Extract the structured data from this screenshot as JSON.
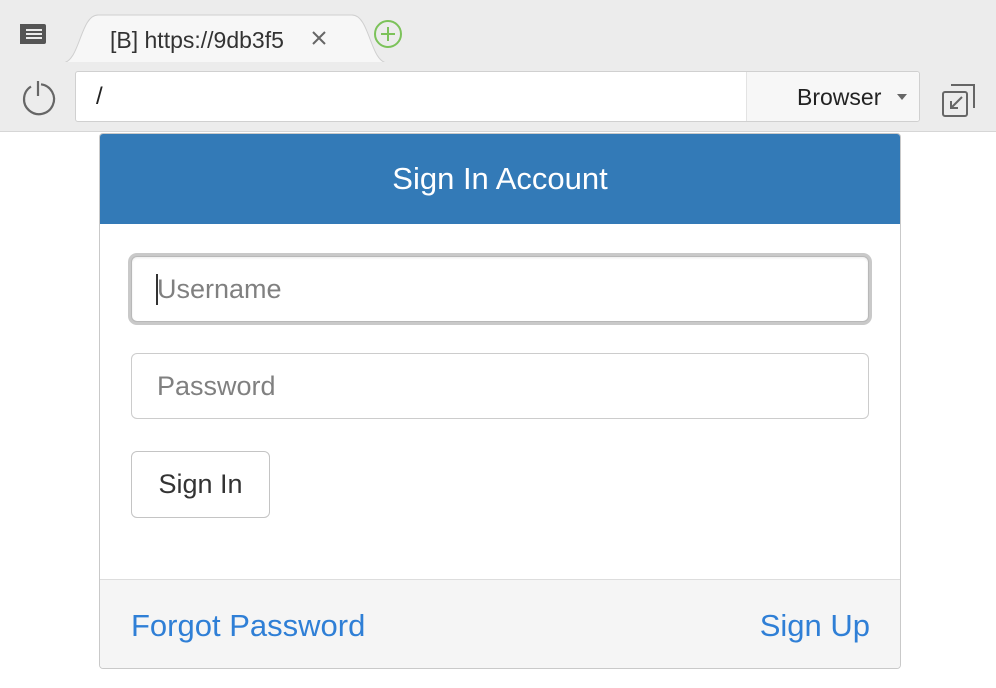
{
  "browser": {
    "tab_title": "[B] https://9db3f5",
    "url": "/",
    "browser_select": "Browser"
  },
  "colors": {
    "header_bg": "#337ab7",
    "link": "#2f7fd6",
    "new_tab_icon": "#7cc25a"
  },
  "icons": {
    "menu": "menu-icon",
    "close_tab": "close-icon",
    "new_tab": "plus-circle-icon",
    "reload": "reload-icon",
    "dropdown": "chevron-down-icon",
    "popout": "popout-icon"
  },
  "login": {
    "heading": "Sign In Account",
    "username_placeholder": "Username",
    "password_placeholder": "Password",
    "signin_label": "Sign In",
    "forgot_label": "Forgot Password",
    "signup_label": "Sign Up"
  }
}
